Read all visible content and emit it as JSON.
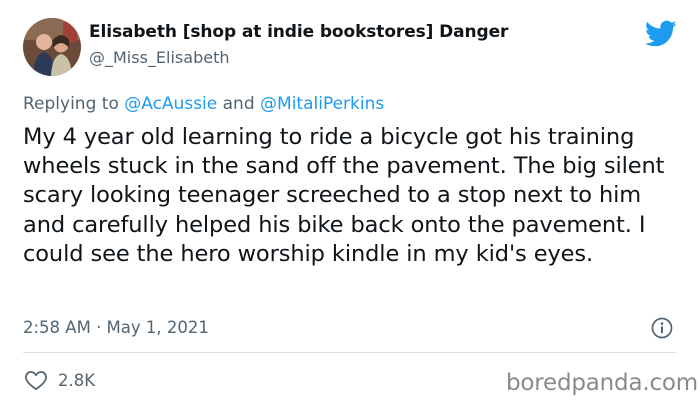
{
  "author": {
    "display_name": "Elisabeth [shop at indie bookstores] Danger",
    "handle": "@_Miss_Elisabeth",
    "avatar_icon": "profile-photo"
  },
  "reply_context": {
    "prefix": "Replying to ",
    "mention_1": "@AcAussie",
    "conjunction": " and ",
    "mention_2": "@MitaliPerkins"
  },
  "tweet": {
    "text": "My 4 year old learning to ride a bicycle got his training wheels stuck in the sand off the pavement. The big silent scary looking teenager screeched to a stop next to him and carefully helped his bike back onto the pavement. I could see the hero worship kindle in my kid's eyes.",
    "timestamp": "2:58 AM · May 1, 2021"
  },
  "actions": {
    "like_icon": "heart-icon",
    "like_count": "2.8K"
  },
  "platform_icon": "twitter-bird-icon",
  "watermark": "boredpanda.com",
  "colors": {
    "brand_blue": "#1d9bf0",
    "text_primary": "#0f1419",
    "text_secondary": "#536471",
    "divider": "#d7dee4"
  }
}
